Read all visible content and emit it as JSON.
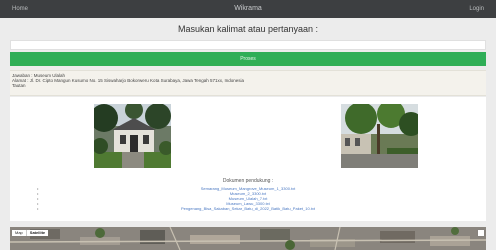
{
  "header": {
    "left_label": "Home",
    "title": "Wikrama",
    "right_label": "Login"
  },
  "query": {
    "prompt": "Masukan kalimat atau pertanyaan :",
    "input_value": "",
    "submit_label": "Proses"
  },
  "info": {
    "lines": [
      "Jawaban : Museum Ulalah",
      "Alamat : Jl. Dr. Cipto Mangun Kusumo No. 15 Siswaharjo Bokorweru Kota Surabaya, Jawa Tengah 571xx, Indonesia",
      "Tautan"
    ]
  },
  "docs": {
    "title": "Dokumen pendukung :",
    "items": [
      "Semarang_Museum_Mangrove_Museum_1_3300.txt",
      "Museum_2_3300.txt",
      "Museum_Ulalah_7.txt",
      "Museum_Lawu_3300.txt",
      "Pengenang_Bisa_Sakaban_Sekar_Batu_di_2022_Batik_Batu_Paket_10.txt"
    ]
  },
  "map": {
    "type_label_1": "Map",
    "type_label_2": "Satellite"
  }
}
